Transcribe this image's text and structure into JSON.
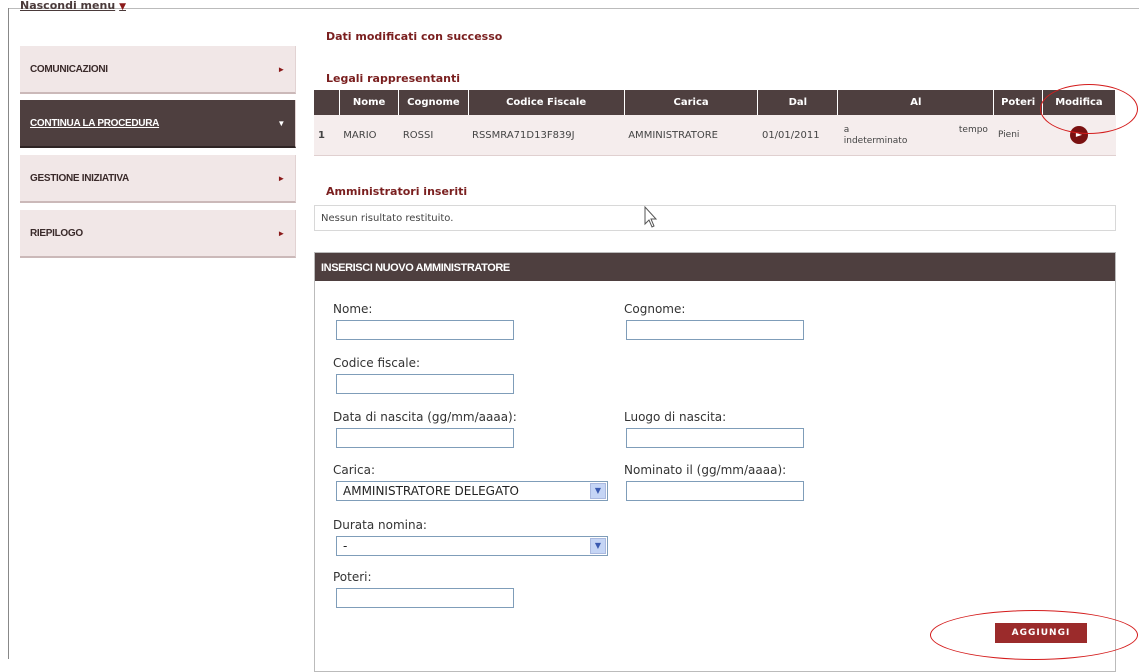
{
  "menu": {
    "hide_label": "Nascondi menu"
  },
  "sidebar": {
    "items": [
      {
        "label": "Comunicazioni"
      },
      {
        "label": "Continua la procedura"
      },
      {
        "label": "Gestione iniziativa"
      },
      {
        "label": "Riepilogo"
      }
    ]
  },
  "main": {
    "success_message": "Dati modificati con successo",
    "legal_reps": {
      "title": "Legali rappresentanti",
      "headers": [
        "",
        "Nome",
        "Cognome",
        "Codice Fiscale",
        "Carica",
        "Dal",
        "Al",
        "Poteri",
        "Modifica"
      ],
      "rows": [
        {
          "index": "1",
          "nome": "MARIO",
          "cognome": "ROSSI",
          "codice_fiscale": "RSSMRA71D13F839J",
          "carica": "AMMINISTRATORE",
          "dal": "01/01/2011",
          "al_a": "a",
          "al_tempo": "tempo",
          "al_indet": "indeterminato",
          "poteri": "Pieni"
        }
      ]
    },
    "admins": {
      "title": "Amministratori inseriti",
      "empty_message": "Nessun risultato restituito."
    },
    "form": {
      "title": "INSERISCI NUOVO AMMINISTRATORE",
      "nome_label": "Nome:",
      "cognome_label": "Cognome:",
      "codice_fiscale_label": "Codice fiscale:",
      "data_nascita_label": "Data di nascita (gg/mm/aaaa):",
      "luogo_nascita_label": "Luogo di nascita:",
      "carica_label": "Carica:",
      "carica_value": "AMMINISTRATORE DELEGATO",
      "nominato_label": "Nominato il (gg/mm/aaaa):",
      "durata_label": "Durata nomina:",
      "durata_value": "-",
      "poteri_label": "Poteri:",
      "add_button": "AGGIUNGI"
    }
  },
  "colors": {
    "header_dark": "#4e3f3f",
    "accent": "#7a1f1f",
    "annotation": "#d41c1c"
  }
}
